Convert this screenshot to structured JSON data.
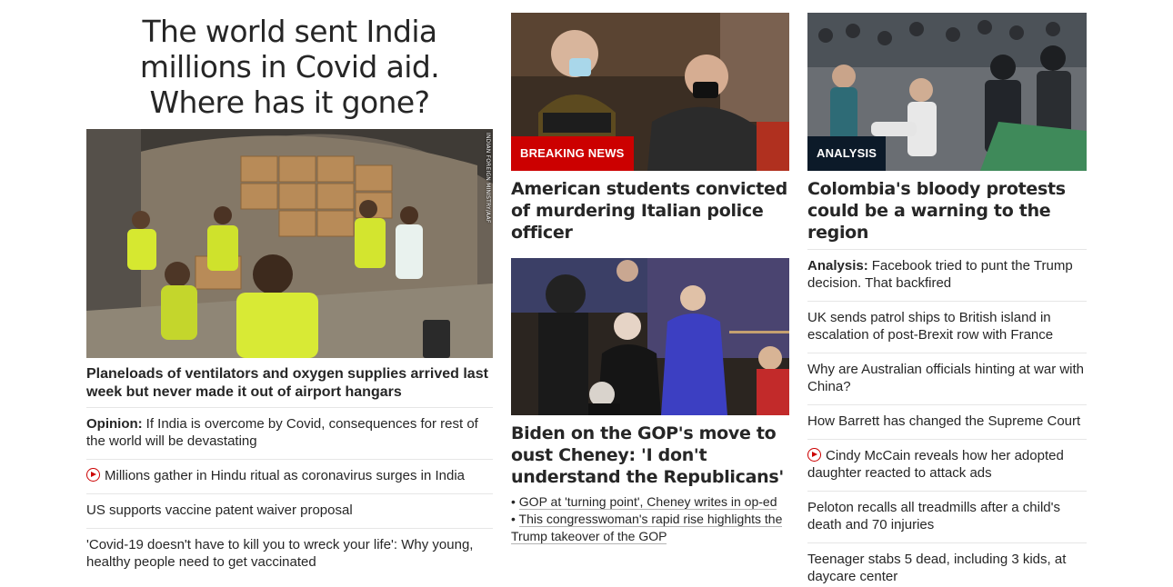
{
  "lead": {
    "headline": "The world sent India millions in Covid aid. Where has it gone?",
    "image_alt": "Workers in high-visibility vests unloading boxes from a cargo plane",
    "photo_credit": "INDIAN FOREIGN MINISTRY/AAF",
    "subhead": "Planeloads of ventilators and oxygen supplies arrived last week but never made it out of airport hangars",
    "links": [
      {
        "kicker": "Opinion:",
        "text": "If India is overcome by Covid, consequences for rest of the world will be devastating"
      },
      {
        "text": "Millions gather in Hindu ritual as coronavirus surges in India",
        "icon": "play-icon"
      },
      {
        "text": "US supports vaccine patent waiver proposal"
      },
      {
        "text": "'Covid-19 doesn't have to kill you to wreck your life': Why young, healthy people need to get vaccinated"
      }
    ]
  },
  "center": {
    "story1": {
      "label": "BREAKING NEWS",
      "headline": "American students convicted of murdering Italian police officer"
    },
    "story2": {
      "headline": "Biden on the GOP's move to oust Cheney: 'I don't understand the Republicans'",
      "bullets": [
        "GOP at 'turning point', Cheney writes in op-ed",
        "This congresswoman's rapid rise highlights the Trump takeover of the GOP"
      ]
    }
  },
  "right": {
    "label": "ANALYSIS",
    "headline": "Colombia's bloody protests could be a warning to the region",
    "links": [
      {
        "kicker": "Analysis:",
        "text": "Facebook tried to punt the Trump decision. That backfired"
      },
      {
        "text": "UK sends patrol ships to British island in escalation of post-Brexit row with France"
      },
      {
        "text": "Why are Australian officials hinting at war with China?"
      },
      {
        "text": "How Barrett has changed the Supreme Court"
      },
      {
        "text": "Cindy McCain reveals how her adopted daughter reacted to attack ads",
        "icon": "play-icon"
      },
      {
        "text": "Peloton recalls all treadmills after a child's death and 70 injuries"
      },
      {
        "text": "Teenager stabs 5 dead, including 3 kids, at daycare center"
      }
    ]
  },
  "colors": {
    "accent": "#cc0000",
    "analysis_label": "#0c1a29",
    "text": "#262626",
    "divider": "#e6e6e6"
  }
}
